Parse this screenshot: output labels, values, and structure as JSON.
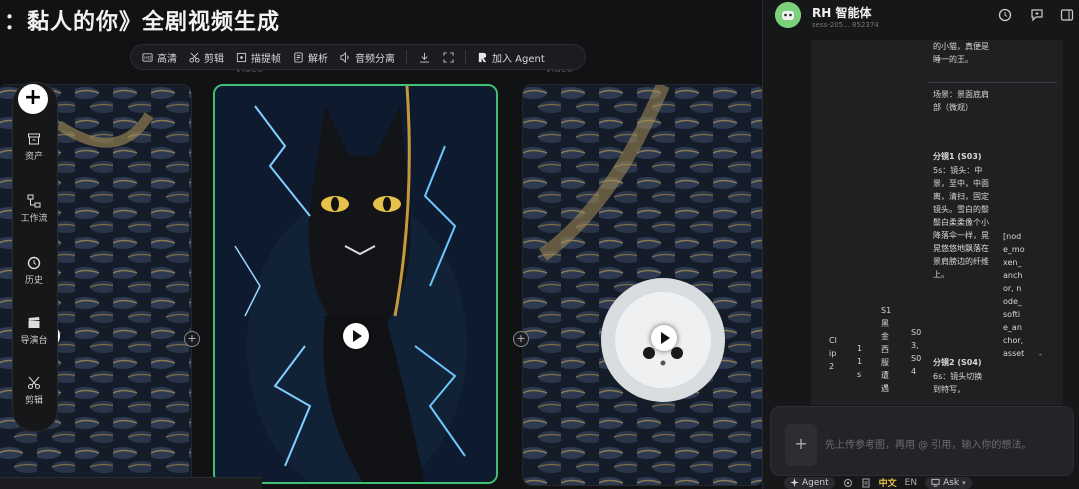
{
  "canvas": {
    "title": "：黏人的你》全剧视频生成",
    "toolbar": {
      "items": [
        {
          "label": "高清",
          "icon": "hd-icon"
        },
        {
          "label": "剪辑",
          "icon": "scissors-icon"
        },
        {
          "label": "描提帧",
          "icon": "frame-icon"
        },
        {
          "label": "解析",
          "icon": "analyze-icon"
        },
        {
          "label": "音频分离",
          "icon": "audio-icon"
        }
      ],
      "agent_label": "加入 Agent"
    },
    "video_tag_left": "Video",
    "video_tag_right": "Video",
    "rail": {
      "add": "+",
      "items": [
        {
          "label": "资产",
          "icon": "archive-icon"
        },
        {
          "label": "工作流",
          "icon": "workflow-icon"
        },
        {
          "label": "历史",
          "icon": "history-icon"
        },
        {
          "label": "导演台",
          "icon": "clapper-icon"
        },
        {
          "label": "剪辑",
          "icon": "scissors-icon"
        }
      ]
    },
    "node_plus": "+"
  },
  "panel": {
    "agent_name": "RH 智能体",
    "agent_id": "sess-205... 852374",
    "chat_cells": {
      "top_frag": "的小猫，真便是睡一的王。",
      "scene": "场景：景面底肩部（微观）",
      "shot1_title": "分镜1 (S03)",
      "shot1_text": "5s：镜头：中景，至中，中面离，清扫，固定镜头。雪白的鬃鬃白柔柔像个小降落伞一样，晃晃悠悠地飘落在景肩膀边的纤维上。",
      "shot2_title": "分镜2 (S04)",
      "shot2_text": "6s：镜头切换到特写，",
      "clip": "Clip 2",
      "dur": "11s",
      "scene_col": "S1 黑金西服遭遇",
      "shots_col": "S03, S04",
      "nodes_col": "[node_moxen_anchor, node_softie_anchor, asset",
      "dash": "-"
    },
    "input_placeholder": "先上传参考图，再用 @ 引用，输入你的想法。",
    "footer": {
      "agent": "Agent",
      "lang_zh": "中文",
      "lang_en": "EN",
      "mode": "Ask"
    },
    "colors": {
      "accent_green": "#3fbf73",
      "avatar_green": "#7ad17a",
      "lang_active": "#e6c14a"
    }
  }
}
